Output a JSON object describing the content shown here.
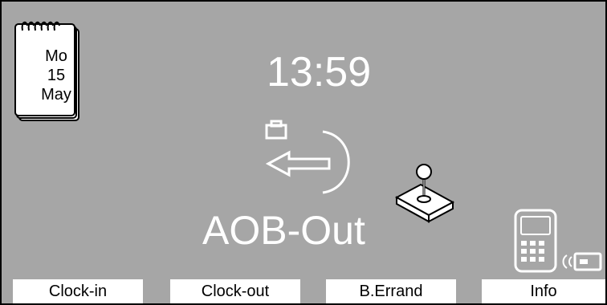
{
  "calendar": {
    "day": "Mo",
    "date": "15",
    "month": "May"
  },
  "clock": {
    "time": "13:59"
  },
  "mode": {
    "label": "AOB-Out",
    "icon": "exit-arrow-icon"
  },
  "icons": {
    "badge": "joystick-badge-icon",
    "reader": "card-reader-icon"
  },
  "softkeys": [
    {
      "label": "Clock-in"
    },
    {
      "label": "Clock-out"
    },
    {
      "label": "B.Errand"
    },
    {
      "label": "Info"
    }
  ],
  "colors": {
    "background": "#a6a6a6",
    "text": "#ffffff",
    "key_bg": "#ffffff",
    "key_text": "#000000"
  }
}
